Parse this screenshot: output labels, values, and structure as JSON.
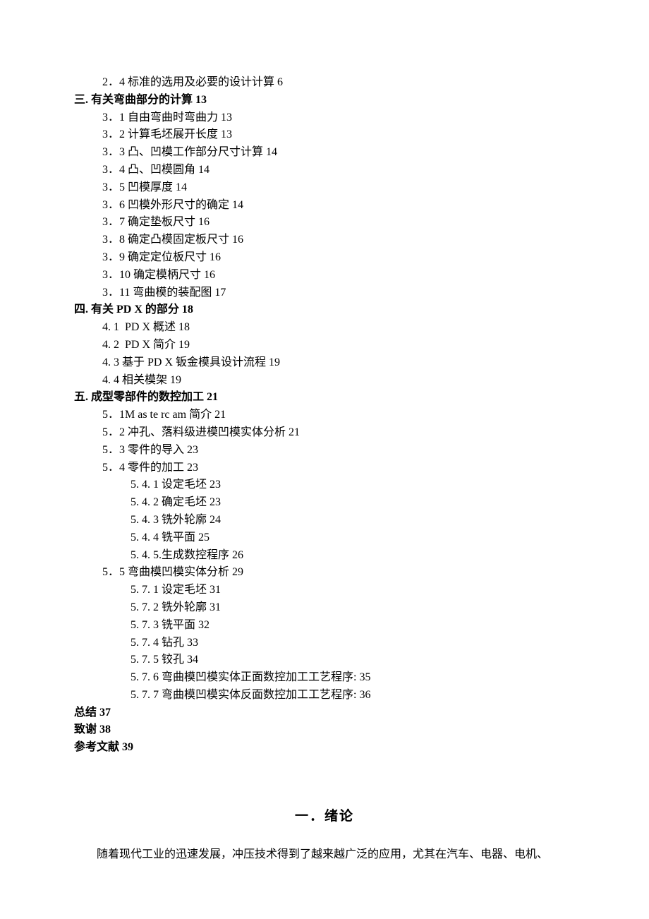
{
  "toc": [
    {
      "level": 2,
      "bold": false,
      "text": "2．4 标准的选用及必要的设计计算 6"
    },
    {
      "level": 1,
      "bold": true,
      "text": "三. 有关弯曲部分的计算 13"
    },
    {
      "level": 2,
      "bold": false,
      "text": "3．1 自由弯曲时弯曲力 13"
    },
    {
      "level": 2,
      "bold": false,
      "text": "3．2 计算毛坯展开长度 13"
    },
    {
      "level": 2,
      "bold": false,
      "text": "3．3 凸、凹模工作部分尺寸计算 14"
    },
    {
      "level": 2,
      "bold": false,
      "text": "3．4 凸、凹模圆角 14"
    },
    {
      "level": 2,
      "bold": false,
      "text": "3．5 凹模厚度 14"
    },
    {
      "level": 2,
      "bold": false,
      "text": "3．6 凹模外形尺寸的确定 14"
    },
    {
      "level": 2,
      "bold": false,
      "text": "3．7 确定垫板尺寸 16"
    },
    {
      "level": 2,
      "bold": false,
      "text": "3．8 确定凸模固定板尺寸 16"
    },
    {
      "level": 2,
      "bold": false,
      "text": "3．9 确定定位板尺寸 16"
    },
    {
      "level": 2,
      "bold": false,
      "text": "3．10 确定模柄尺寸 16"
    },
    {
      "level": 2,
      "bold": false,
      "text": "3．11 弯曲模的装配图 17"
    },
    {
      "level": 1,
      "bold": true,
      "text": "四. 有关 PD X 的部分 18"
    },
    {
      "level": 2,
      "bold": false,
      "text": "4. 1  PD X 概述 18"
    },
    {
      "level": 2,
      "bold": false,
      "text": "4. 2  PD X 简介 19"
    },
    {
      "level": 2,
      "bold": false,
      "text": "4. 3 基于 PD X 钣金模具设计流程 19"
    },
    {
      "level": 2,
      "bold": false,
      "text": "4. 4 相关模架 19"
    },
    {
      "level": 1,
      "bold": true,
      "text": "五. 成型零部件的数控加工 21"
    },
    {
      "level": 2,
      "bold": false,
      "text": "5．1M as te rc am 简介 21"
    },
    {
      "level": 2,
      "bold": false,
      "text": "5．2 冲孔、落料级进模凹模实体分析 21"
    },
    {
      "level": 2,
      "bold": false,
      "text": "5．3 零件的导入 23"
    },
    {
      "level": 2,
      "bold": false,
      "text": "5．4 零件的加工 23"
    },
    {
      "level": 3,
      "bold": false,
      "text": "5. 4. 1 设定毛坯 23"
    },
    {
      "level": 3,
      "bold": false,
      "text": "5. 4. 2 确定毛坯 23"
    },
    {
      "level": 3,
      "bold": false,
      "text": "5. 4. 3 铣外轮廓 24"
    },
    {
      "level": 3,
      "bold": false,
      "text": "5. 4. 4 铣平面 25"
    },
    {
      "level": 3,
      "bold": false,
      "text": "5. 4. 5.生成数控程序 26"
    },
    {
      "level": 2,
      "bold": false,
      "text": "5．5 弯曲模凹模实体分析 29"
    },
    {
      "level": 3,
      "bold": false,
      "text": "5. 7. 1 设定毛坯 31"
    },
    {
      "level": 3,
      "bold": false,
      "text": "5. 7. 2 铣外轮廓 31"
    },
    {
      "level": 3,
      "bold": false,
      "text": "5. 7. 3 铣平面 32"
    },
    {
      "level": 3,
      "bold": false,
      "text": "5. 7. 4 钻孔 33"
    },
    {
      "level": 3,
      "bold": false,
      "text": "5. 7. 5 铰孔 34"
    },
    {
      "level": 3,
      "bold": false,
      "text": "5. 7. 6 弯曲模凹模实体正面数控加工工艺程序: 35"
    },
    {
      "level": 3,
      "bold": false,
      "text": "5. 7. 7 弯曲模凹模实体反面数控加工工艺程序: 36"
    },
    {
      "level": 1,
      "bold": true,
      "text": "总结 37"
    },
    {
      "level": 1,
      "bold": true,
      "text": "致谢 38"
    },
    {
      "level": 1,
      "bold": true,
      "text": "参考文献 39"
    }
  ],
  "heading": "一．绪论",
  "body": "随着现代工业的迅速发展，冲压技术得到了越来越广泛的应用，尤其在汽车、电器、电机、"
}
